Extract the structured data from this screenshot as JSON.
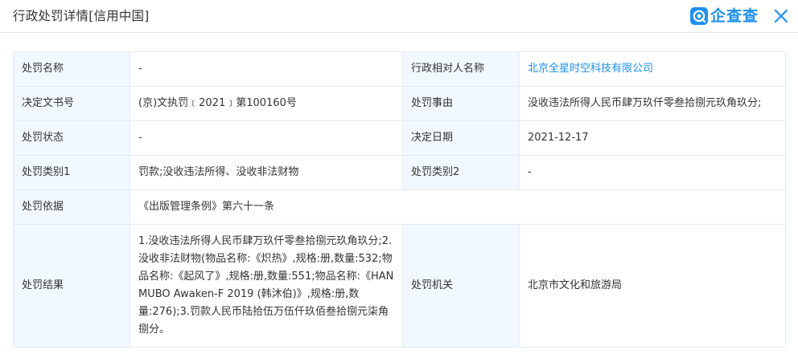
{
  "header": {
    "title": "行政处罚详情[信用中国]",
    "brand_name": "企查查",
    "brand_color": "#1c8ff0"
  },
  "icons": {
    "logo": "qichacha-logo-icon",
    "close": "close-icon"
  },
  "fields": {
    "penalty_name_label": "处罚名称",
    "penalty_name_value": "-",
    "counterparty_label": "行政相对人名称",
    "counterparty_value": "北京全星时空科技有限公司",
    "doc_no_label": "决定文书号",
    "doc_no_value": "(京)文执罚﹝2021﹞第100160号",
    "reason_label": "处罚事由",
    "reason_value": "没收违法所得人民币肆万玖仟零叁拾捌元玖角玖分;",
    "status_label": "处罚状态",
    "status_value": "-",
    "date_label": "决定日期",
    "date_value": "2021-12-17",
    "category1_label": "处罚类别1",
    "category1_value": "罚款;没收违法所得、没收非法财物",
    "category2_label": "处罚类别2",
    "category2_value": "-",
    "basis_label": "处罚依据",
    "basis_value": "《出版管理条例》第六十一条",
    "result_label": "处罚结果",
    "result_value": "1.没收违法所得人民币肆万玖仟零叁拾捌元玖角玖分;2.没收非法财物(物品名称:《炽热》,规格:册,数量:532;物品名称:《起风了》,规格:册,数量:551;物品名称:《HAN MUBO Awaken-F 2019 (韩沐伯)》,规格:册,数量:276);3.罚款人民币陆拾伍万伍仟玖佰叁拾捌元柒角捌分。",
    "authority_label": "处罚机关",
    "authority_value": "北京市文化和旅游局"
  }
}
